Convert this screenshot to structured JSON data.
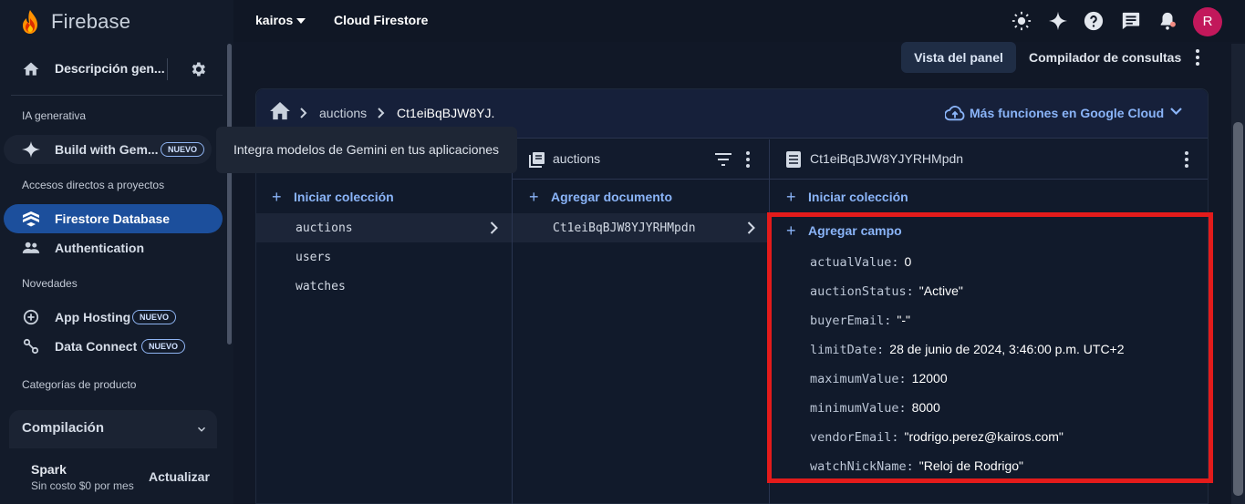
{
  "brand": {
    "name": "Firebase"
  },
  "sidebar": {
    "overview_label": "Descripción gen...",
    "section_ai": "IA generativa",
    "gemini_label": "Build with Gem...",
    "gemini_badge": "NUEVO",
    "section_shortcuts": "Accesos directos a proyectos",
    "firestore_label": "Firestore Database",
    "auth_label": "Authentication",
    "section_news": "Novedades",
    "hosting_label": "App Hosting",
    "hosting_badge": "NUEVO",
    "dataconnect_label": "Data Connect",
    "dataconnect_badge": "NUEVO",
    "section_categories": "Categorías de producto",
    "compile_label": "Compilación",
    "plan_name": "Spark",
    "plan_sub": "Sin costo $0 por mes",
    "upgrade_label": "Actualizar"
  },
  "tooltip": {
    "text": "Integra modelos de Gemini en tus aplicaciones"
  },
  "topbar": {
    "project": "kairos",
    "product": "Cloud Firestore",
    "avatar_letter": "R"
  },
  "views": {
    "panel_view": "Vista del panel",
    "query_builder": "Compilador de consultas"
  },
  "breadcrumb": {
    "items": [
      "auctions",
      "Ct1eiBqBJW8YJ."
    ],
    "cloud_link": "Más funciones en Google Cloud"
  },
  "columns": {
    "root": {
      "add_label": "Iniciar colección",
      "items": [
        "auctions",
        "users",
        "watches"
      ]
    },
    "collection": {
      "title": "auctions",
      "add_label": "Agregar documento",
      "items": [
        "Ct1eiBqBJW8YJYRHMpdn"
      ]
    },
    "document": {
      "title": "Ct1eiBqBJW8YJYRHMpdn",
      "add_collection_label": "Iniciar colección",
      "add_field_label": "Agregar campo",
      "fields": [
        {
          "key": "actualValue:",
          "value": "0"
        },
        {
          "key": "auctionStatus:",
          "value": "\"Active\""
        },
        {
          "key": "buyerEmail:",
          "value": "\"-\""
        },
        {
          "key": "limitDate:",
          "value": "28 de junio de 2024, 3:46:00 p.m. UTC+2"
        },
        {
          "key": "maximumValue:",
          "value": "12000"
        },
        {
          "key": "minimumValue:",
          "value": "8000"
        },
        {
          "key": "vendorEmail:",
          "value": "\"rodrigo.perez@kairos.com\""
        },
        {
          "key": "watchNickName:",
          "value": "\"Reloj de Rodrigo\""
        }
      ]
    }
  },
  "colors": {
    "accent": "#8ab4f8",
    "highlight_box": "#e31b1b",
    "active_nav": "#1c4f9c",
    "avatar": "#c2185b"
  }
}
